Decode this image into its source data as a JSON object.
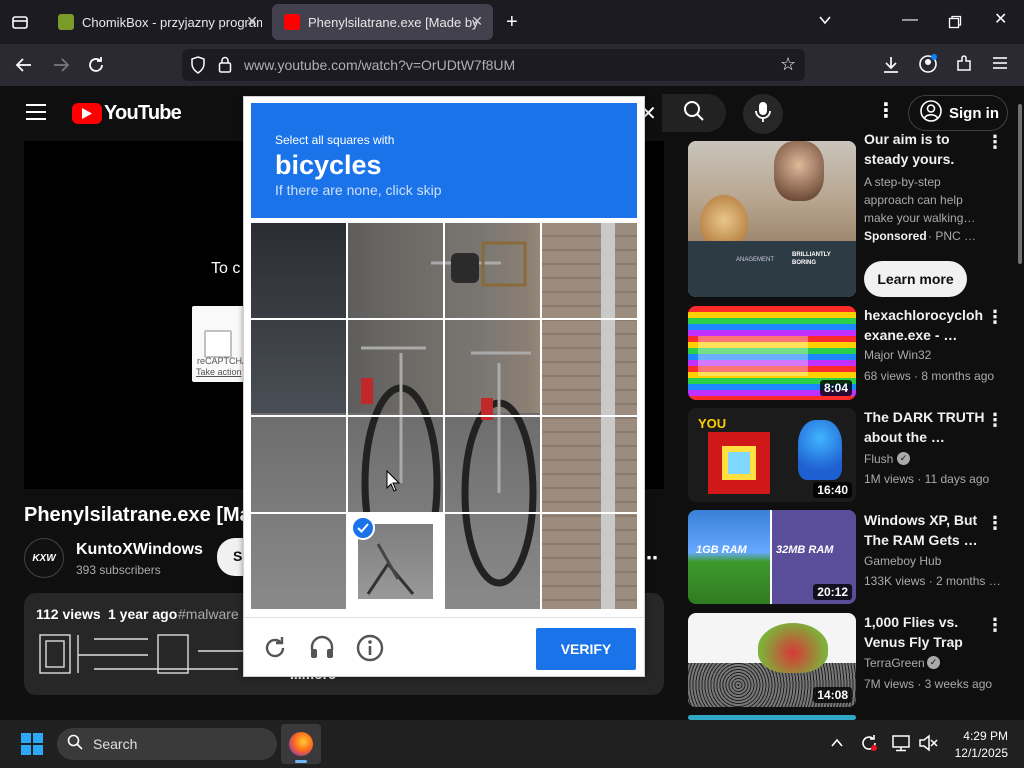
{
  "browser": {
    "tabs": [
      {
        "title": "ChomikBox - przyjazny program"
      },
      {
        "title": "Phenylsilatrane.exe [Made by @"
      }
    ],
    "url": "www.youtube.com/watch?v=OrUDtW7f8UM"
  },
  "youtube": {
    "logo_text": "YouTube",
    "sign_in": "Sign in",
    "behind_text_1": "To c",
    "behind_recaptcha_text": "reCAPTCHA",
    "behind_take_action": "Take action",
    "video_title": "Phenylsilatrane.exe [Ma",
    "channel": {
      "name": "KuntoXWindows",
      "subscribers": "393 subscribers",
      "avatar_text": "KXW"
    },
    "subscribe_partial": "S",
    "description": {
      "views": "112 views",
      "age": "1 year ago",
      "tag": "#malware",
      "more": "...more"
    },
    "sidebar": [
      {
        "title_lines": [
          "Our aim is to",
          "steady yours."
        ],
        "channel": "A step-by-step approach can help make your walking…",
        "meta_sponsored": "Sponsored",
        "meta_brand": "· PNC …",
        "cta": "Learn more",
        "ad_brand_text": "BRILLIANTLY BORING",
        "ad_mgmt": "ANAGEMENT"
      },
      {
        "title": "hexachlorocycloh exane.exe - …",
        "channel": "Major Win32",
        "meta": "68 views · 8 months ago",
        "duration": "8:04"
      },
      {
        "title": "The DARK TRUTH about the …",
        "channel": "Flush",
        "meta": "1M views · 11 days ago",
        "duration": "16:40",
        "thumb_text": "YOU"
      },
      {
        "title": "Windows XP, But The RAM Gets …",
        "channel": "Gameboy Hub",
        "meta": "133K views · 2 months …",
        "duration": "20:12",
        "thumb_left": "1GB RAM",
        "thumb_right": "32MB RAM"
      },
      {
        "title": "1,000 Flies vs. Venus Fly Trap",
        "channel": "TerraGreen",
        "meta": "7M views · 3 weeks ago",
        "duration": "14:08"
      }
    ]
  },
  "captcha": {
    "instruction": "Select all squares with",
    "target": "bicycles",
    "hint": "If there are none, click skip",
    "verify_label": "VERIFY"
  },
  "taskbar": {
    "search_label": "Search",
    "time": "4:29 PM",
    "date": "12/1/2025"
  },
  "colors": {
    "accent": "#1a73e8",
    "youtube_red": "#ff0000",
    "page_bg": "#0f0f0f"
  }
}
